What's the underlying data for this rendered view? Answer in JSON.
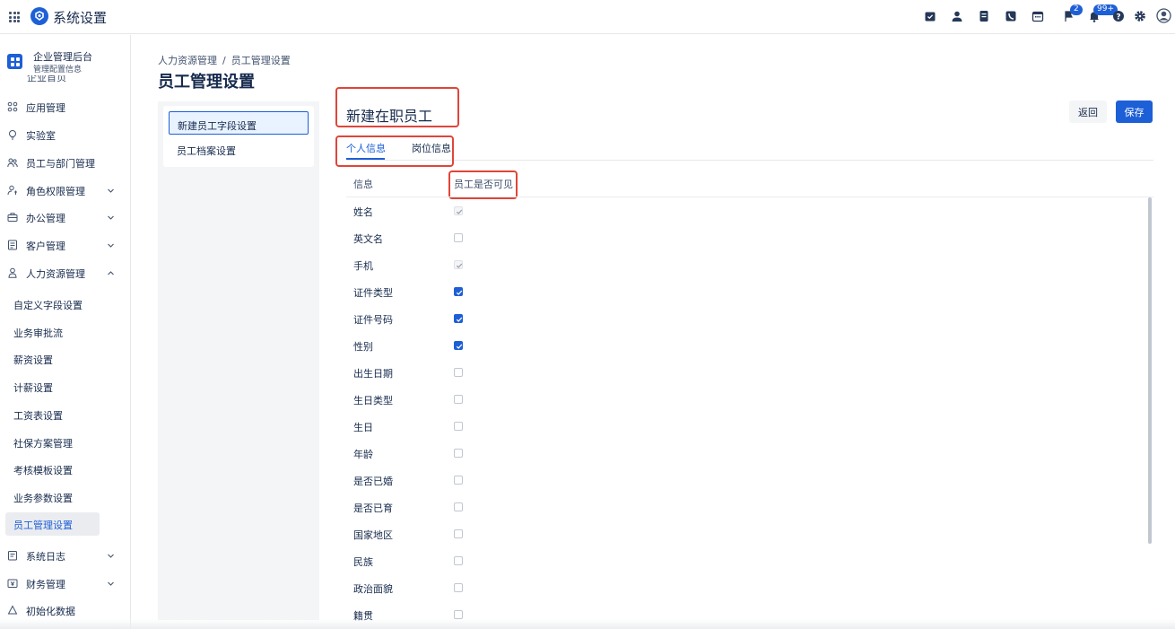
{
  "app": {
    "title": "系统设置"
  },
  "topbar": {
    "icons": [
      "calendar-check-icon",
      "user-icon",
      "document-icon",
      "phone-icon",
      "calendar-icon",
      "flag-icon",
      "bell-icon",
      "help-icon",
      "gear-icon",
      "avatar-icon"
    ],
    "flag_badge": "2",
    "bell_badge": "99+"
  },
  "sidebar": {
    "org_name": "企业管理后台",
    "org_sub": "管理配置信息",
    "peek_label": "企业首页",
    "items": [
      {
        "label": "应用管理",
        "icon": "apps-icon"
      },
      {
        "label": "实验室",
        "icon": "bulb-icon"
      },
      {
        "label": "员工与部门管理",
        "icon": "people-icon"
      },
      {
        "label": "角色权限管理",
        "icon": "role-icon"
      },
      {
        "label": "办公管理",
        "icon": "briefcase-icon"
      },
      {
        "label": "客户管理",
        "icon": "customer-icon"
      },
      {
        "label": "人力资源管理",
        "icon": "person-icon"
      }
    ],
    "sub_items": [
      "自定义字段设置",
      "业务审批流",
      "薪资设置",
      "计薪设置",
      "工资表设置",
      "社保方案管理",
      "考核模板设置",
      "业务参数设置",
      "员工管理设置"
    ],
    "bottom_items": [
      {
        "label": "系统日志",
        "icon": "log-icon"
      },
      {
        "label": "财务管理",
        "icon": "finance-icon"
      },
      {
        "label": "初始化数据",
        "icon": "recycle-icon"
      }
    ]
  },
  "breadcrumb": {
    "parent": "人力资源管理",
    "separator": "/",
    "current": "员工管理设置"
  },
  "page_title": "员工管理设置",
  "settings_menu": [
    "新建员工字段设置",
    "员工档案设置"
  ],
  "form": {
    "title": "新建在职员工",
    "back_label": "返回",
    "save_label": "保存",
    "tabs": [
      "个人信息",
      "岗位信息"
    ],
    "col_info": "信息",
    "col_visible": "员工是否可见",
    "rows": [
      {
        "label": "姓名",
        "state": "disabled-checked"
      },
      {
        "label": "英文名",
        "state": "unchecked"
      },
      {
        "label": "手机",
        "state": "disabled-checked"
      },
      {
        "label": "证件类型",
        "state": "checked"
      },
      {
        "label": "证件号码",
        "state": "checked"
      },
      {
        "label": "性别",
        "state": "checked"
      },
      {
        "label": "出生日期",
        "state": "unchecked"
      },
      {
        "label": "生日类型",
        "state": "unchecked"
      },
      {
        "label": "生日",
        "state": "unchecked"
      },
      {
        "label": "年龄",
        "state": "unchecked"
      },
      {
        "label": "是否已婚",
        "state": "unchecked"
      },
      {
        "label": "是否已育",
        "state": "unchecked"
      },
      {
        "label": "国家地区",
        "state": "unchecked"
      },
      {
        "label": "民族",
        "state": "unchecked"
      },
      {
        "label": "政治面貌",
        "state": "unchecked"
      },
      {
        "label": "籍贯",
        "state": "unchecked"
      }
    ]
  },
  "colors": {
    "accent": "#1d5fd6",
    "highlight": "#e0453a"
  }
}
